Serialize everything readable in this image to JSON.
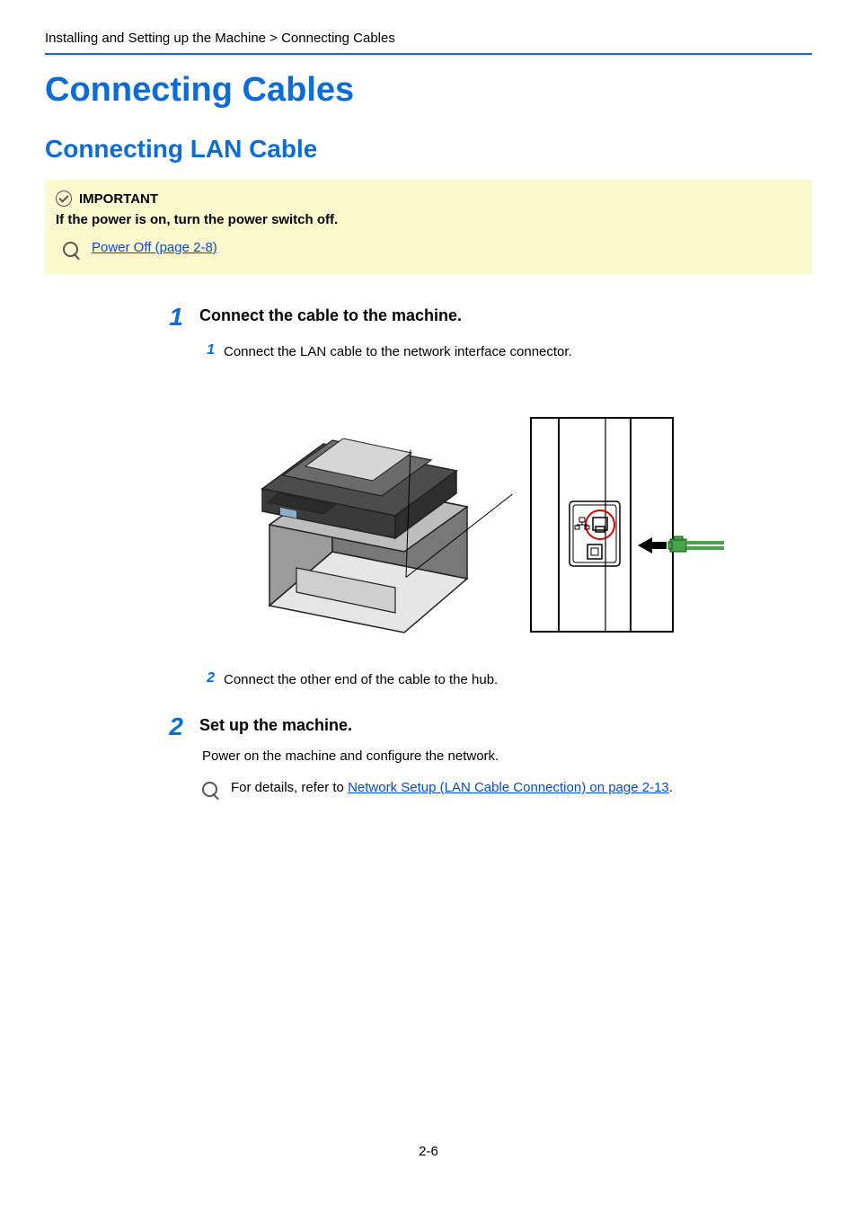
{
  "breadcrumb": "Installing and Setting up the Machine > Connecting Cables",
  "h1": "Connecting Cables",
  "h2": "Connecting LAN Cable",
  "note": {
    "label": "IMPORTANT",
    "body": "If the power is on, turn the power switch off.",
    "ref": "Power Off (page 2-8)"
  },
  "steps": [
    {
      "num": "1",
      "title": "Connect the cable to the machine.",
      "subs": [
        {
          "num": "1",
          "text": "Connect the LAN cable to the network interface connector."
        },
        {
          "num": "2",
          "text": "Connect the other end of the cable to the hub."
        }
      ]
    },
    {
      "num": "2",
      "title": "Set up the machine.",
      "body": "Power on the machine and configure the network.",
      "ref_prefix": "For details, refer to ",
      "ref_link": "Network Setup (LAN Cable Connection) on page 2-13",
      "ref_suffix": "."
    }
  ],
  "page_number": "2-6"
}
